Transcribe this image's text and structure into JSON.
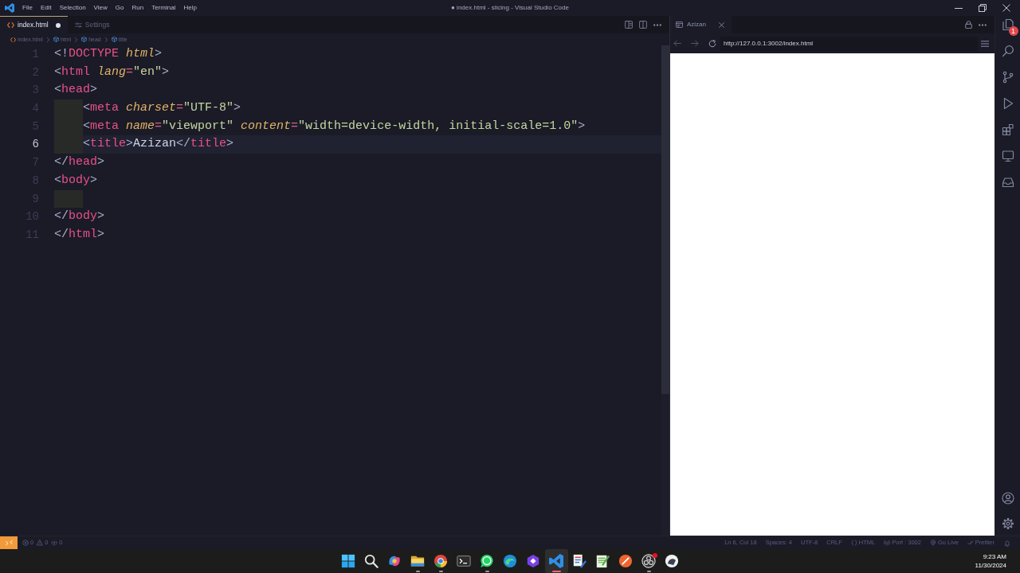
{
  "window": {
    "title": "● index.html - slicing - Visual Studio Code"
  },
  "menu": [
    "File",
    "Edit",
    "Selection",
    "View",
    "Go",
    "Run",
    "Terminal",
    "Help"
  ],
  "editor_tabs": [
    {
      "kind": "file",
      "label": "index.html",
      "selected": true,
      "modified": true
    },
    {
      "kind": "settings",
      "label": "Settings",
      "selected": false,
      "modified": false
    }
  ],
  "breadcrumb": [
    {
      "kind": "file",
      "label": "index.html"
    },
    {
      "kind": "element",
      "label": "html"
    },
    {
      "kind": "element",
      "label": "head"
    },
    {
      "kind": "element",
      "label": "title"
    }
  ],
  "code_lines": [
    {
      "number": "1",
      "indented": false,
      "active": false,
      "tokens": [
        {
          "kind": "punct",
          "text": "<!"
        },
        {
          "kind": "tag",
          "text": "DOCTYPE"
        },
        {
          "kind": "attr",
          "text": " html"
        },
        {
          "kind": "punct",
          "text": ">"
        }
      ]
    },
    {
      "number": "2",
      "indented": false,
      "active": false,
      "tokens": [
        {
          "kind": "punct",
          "text": "<"
        },
        {
          "kind": "tag",
          "text": "html"
        },
        {
          "kind": "attr",
          "text": " lang"
        },
        {
          "kind": "op",
          "text": "="
        },
        {
          "kind": "string",
          "text": "\"en\""
        },
        {
          "kind": "punct",
          "text": ">"
        }
      ]
    },
    {
      "number": "3",
      "indented": false,
      "active": false,
      "tokens": [
        {
          "kind": "punct",
          "text": "<"
        },
        {
          "kind": "tag",
          "text": "head"
        },
        {
          "kind": "punct",
          "text": ">"
        }
      ]
    },
    {
      "number": "4",
      "indented": true,
      "active": false,
      "tokens": [
        {
          "kind": "punct",
          "text": "<"
        },
        {
          "kind": "tag",
          "text": "meta"
        },
        {
          "kind": "attr",
          "text": " charset"
        },
        {
          "kind": "op",
          "text": "="
        },
        {
          "kind": "string",
          "text": "\"UTF-8\""
        },
        {
          "kind": "punct",
          "text": ">"
        }
      ]
    },
    {
      "number": "5",
      "indented": true,
      "active": false,
      "tokens": [
        {
          "kind": "punct",
          "text": "<"
        },
        {
          "kind": "tag",
          "text": "meta"
        },
        {
          "kind": "attr",
          "text": " name"
        },
        {
          "kind": "op",
          "text": "="
        },
        {
          "kind": "string",
          "text": "\"viewport\""
        },
        {
          "kind": "attr",
          "text": " content"
        },
        {
          "kind": "op",
          "text": "="
        },
        {
          "kind": "string",
          "text": "\"width=device-width, initial-scale=1.0\""
        },
        {
          "kind": "punct",
          "text": ">"
        }
      ]
    },
    {
      "number": "6",
      "indented": true,
      "active": true,
      "tokens": [
        {
          "kind": "punct",
          "text": "<"
        },
        {
          "kind": "tag",
          "text": "title"
        },
        {
          "kind": "punct",
          "text": ">"
        },
        {
          "kind": "plain",
          "text": "Azizan"
        },
        {
          "kind": "punct",
          "text": "</"
        },
        {
          "kind": "tag",
          "text": "title"
        },
        {
          "kind": "punct",
          "text": ">"
        }
      ]
    },
    {
      "number": "7",
      "indented": false,
      "active": false,
      "tokens": [
        {
          "kind": "punct",
          "text": "</"
        },
        {
          "kind": "tag",
          "text": "head"
        },
        {
          "kind": "punct",
          "text": ">"
        }
      ]
    },
    {
      "number": "8",
      "indented": false,
      "active": false,
      "tokens": [
        {
          "kind": "punct",
          "text": "<"
        },
        {
          "kind": "tag",
          "text": "body"
        },
        {
          "kind": "punct",
          "text": ">"
        }
      ]
    },
    {
      "number": "9",
      "indented": true,
      "active": false
    },
    {
      "number": "10",
      "indented": false,
      "active": false,
      "tokens": [
        {
          "kind": "punct",
          "text": "</"
        },
        {
          "kind": "tag",
          "text": "body"
        },
        {
          "kind": "punct",
          "text": ">"
        }
      ]
    },
    {
      "number": "11",
      "indented": false,
      "active": false,
      "tokens": [
        {
          "kind": "punct",
          "text": "</"
        },
        {
          "kind": "tag",
          "text": "html"
        },
        {
          "kind": "punct",
          "text": ">"
        }
      ]
    }
  ],
  "browser": {
    "tab": {
      "label": "Azizan"
    },
    "url": "http://127.0.0.1:3002/index.html"
  },
  "activity_bar": {
    "badge": "1"
  },
  "status_bar": {
    "left": [
      {
        "kind": "errors",
        "label": "0"
      },
      {
        "kind": "warnings",
        "label": "0"
      },
      {
        "kind": "ports",
        "label": "0"
      }
    ],
    "right": [
      {
        "kind": "text",
        "label": "Ln 6, Col 18"
      },
      {
        "kind": "text",
        "label": "Spaces: 4"
      },
      {
        "kind": "text",
        "label": "UTF-8"
      },
      {
        "kind": "text",
        "label": "CRLF"
      },
      {
        "kind": "language",
        "label": "HTML"
      },
      {
        "kind": "port",
        "label": "Port : 3002"
      },
      {
        "kind": "live",
        "label": "Go Live"
      },
      {
        "kind": "formatter",
        "label": "Prettier"
      }
    ]
  },
  "taskbar": {
    "apps": [
      {
        "kind": "start",
        "running": false,
        "active": false,
        "alert": false
      },
      {
        "kind": "search",
        "running": false,
        "active": false,
        "alert": false
      },
      {
        "kind": "swirl",
        "running": false,
        "active": false,
        "alert": false
      },
      {
        "kind": "folder",
        "running": true,
        "active": false,
        "alert": false
      },
      {
        "kind": "browser",
        "running": true,
        "active": false,
        "alert": false
      },
      {
        "kind": "terminal",
        "running": false,
        "active": false,
        "alert": false
      },
      {
        "kind": "chat",
        "running": true,
        "active": false,
        "alert": false
      },
      {
        "kind": "wave",
        "running": false,
        "active": false,
        "alert": false
      },
      {
        "kind": "hexagon",
        "running": false,
        "active": false,
        "alert": false
      },
      {
        "kind": "editor",
        "running": true,
        "active": true,
        "alert": false
      },
      {
        "kind": "document",
        "running": false,
        "active": false,
        "alert": false
      },
      {
        "kind": "notepad",
        "running": false,
        "active": false,
        "alert": false
      },
      {
        "kind": "slash",
        "running": false,
        "active": false,
        "alert": false
      },
      {
        "kind": "aperture",
        "running": true,
        "active": false,
        "alert": true
      },
      {
        "kind": "disc",
        "running": false,
        "active": false,
        "alert": false
      }
    ],
    "time": "9:23 AM",
    "date": "11/30/2024"
  }
}
